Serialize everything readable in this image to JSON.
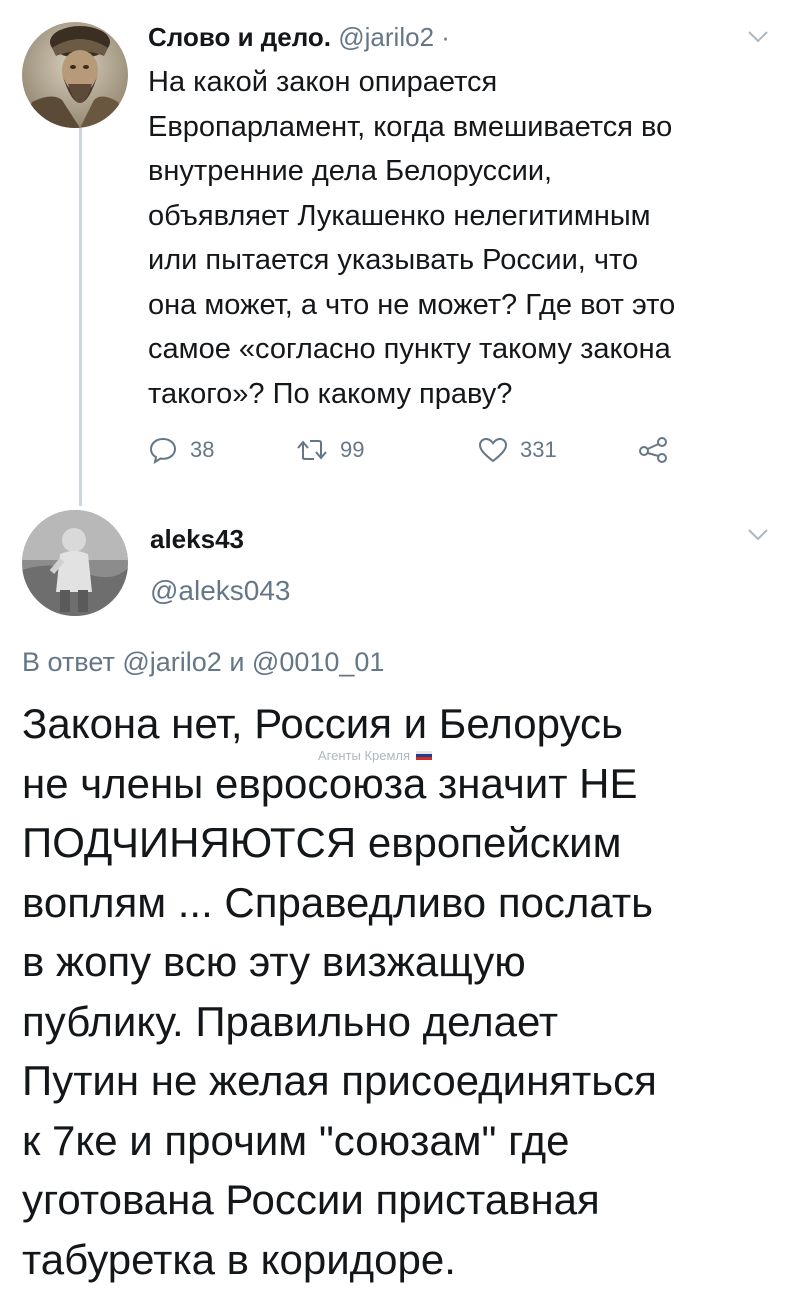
{
  "tweet1": {
    "author_name": "Слово и дело.",
    "author_handle": "@jarilo2 ·",
    "text_lines": [
      "На какой закон опирается",
      "Европарламент, когда вмешивается во",
      "внутренние дела Белоруссии,",
      "объявляет Лукашенко нелегитимным",
      "или пытается указывать России, что",
      "она может, а что не может? Где вот это",
      "самое «согласно пункту такому закона",
      "такого»? По какому праву?"
    ],
    "replies": "38",
    "retweets": "99",
    "likes": "331"
  },
  "tweet2": {
    "author_name": "aleks43",
    "author_handle": "@aleks043",
    "reply_prefix": "В ответ",
    "reply_mention_1": "@jarilo2",
    "reply_and": "и",
    "reply_mention_2": "@0010_01",
    "text_lines": [
      "Закона нет, Россия и Белорусь",
      "не члены евросоюза значит НЕ",
      "ПОДЧИНЯЮТСЯ европейским",
      "воплям ... Справедливо послать",
      "в жопу всю эту визжащую",
      "публику. Правильно делает",
      "Путин не желая присоединяться",
      "к 7ке и прочим \"союзам\" где",
      "уготована России приставная",
      "табуретка в коридоре."
    ]
  },
  "watermark": {
    "text": "Агенты Кремля",
    "flag_colors": [
      "#ffffff",
      "#1c3f94",
      "#d52b1e"
    ]
  },
  "icons": [
    "reply-icon",
    "retweet-icon",
    "like-icon",
    "share-icon",
    "chevron-down-icon"
  ],
  "colors": {
    "text": "#14171a",
    "secondary": "#657786",
    "thread_line": "#ccd6dd"
  }
}
